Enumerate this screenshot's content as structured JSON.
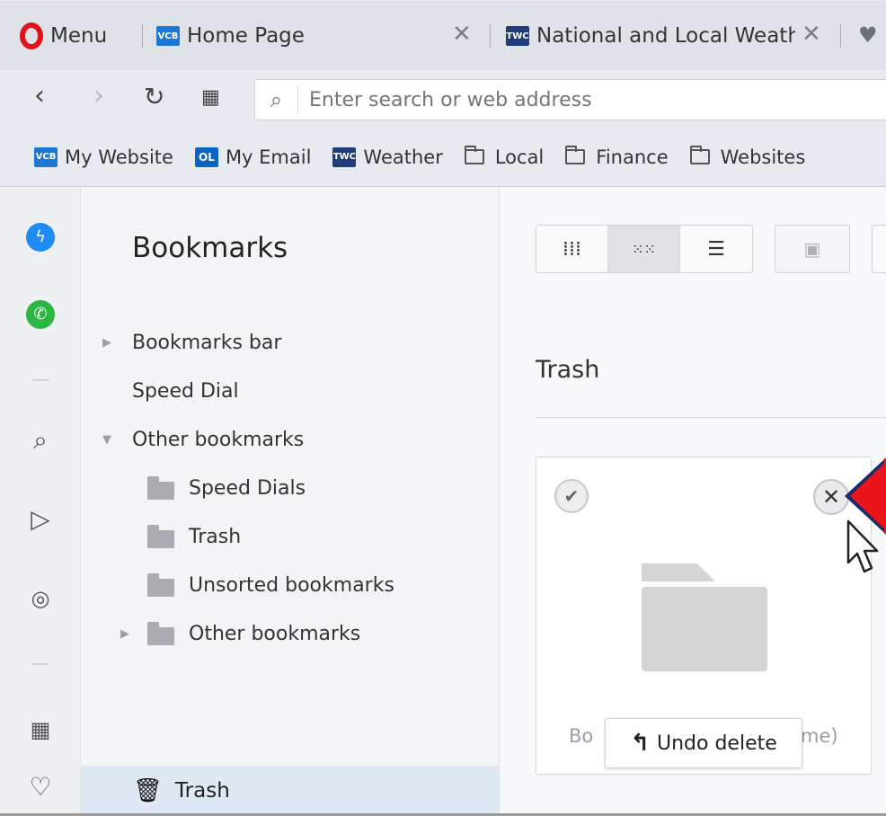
{
  "tabbar": {
    "menu_label": "Menu",
    "tabs": [
      {
        "favicon": "VCB",
        "title": "Home Page"
      },
      {
        "favicon": "TWC",
        "title": "National and Local Weathe"
      }
    ],
    "extra_tab_icon": "heart-icon"
  },
  "address": {
    "placeholder": "Enter search or web address"
  },
  "bookmarks_bar": {
    "items": [
      {
        "favicon": "VCB",
        "label": "My Website"
      },
      {
        "favicon": "OL",
        "label": "My Email"
      },
      {
        "favicon": "TWC",
        "label": "Weather"
      },
      {
        "icon": "folder-icon",
        "label": "Local"
      },
      {
        "icon": "folder-icon",
        "label": "Finance"
      },
      {
        "icon": "folder-icon",
        "label": "Websites"
      }
    ]
  },
  "sidebar": {
    "title": "Bookmarks",
    "tree": [
      {
        "label": "Bookmarks bar"
      },
      {
        "label": "Speed Dial"
      },
      {
        "label": "Other bookmarks"
      },
      {
        "label": "Speed Dials"
      },
      {
        "label": "Trash"
      },
      {
        "label": "Unsorted bookmarks"
      },
      {
        "label": "Other bookmarks"
      }
    ],
    "trash_label": "Trash"
  },
  "main": {
    "section_title": "Trash",
    "card": {
      "label_start": "Bo",
      "label_end": "me)",
      "undo_label": "Undo delete"
    }
  },
  "colors": {
    "opera_red": "#e0131d",
    "accent_selected": "#dfe9f4",
    "callout_arrow": "#e8141a"
  }
}
